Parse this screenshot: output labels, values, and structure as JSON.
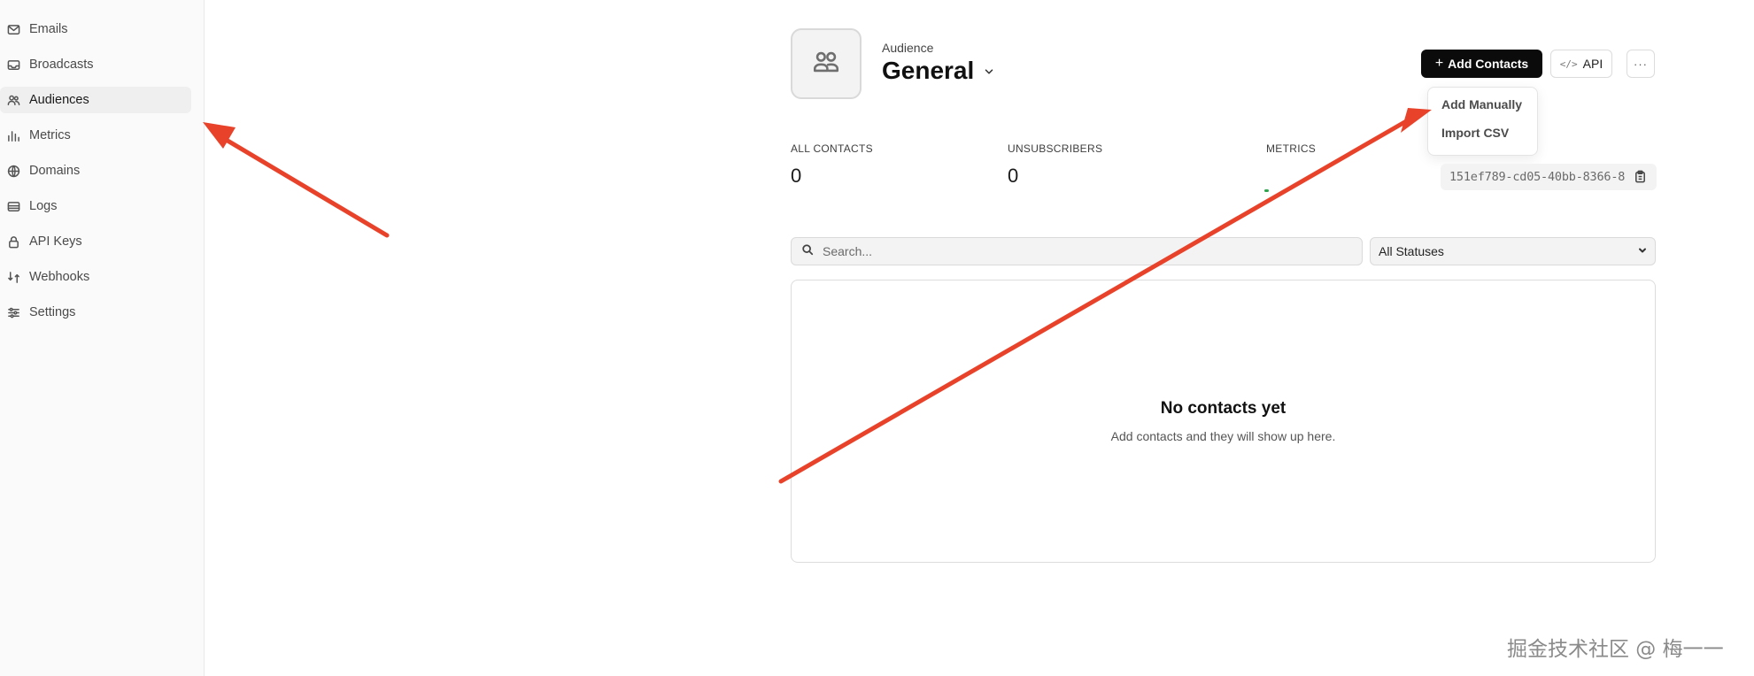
{
  "sidebar": {
    "items": [
      {
        "label": "Emails",
        "icon": "mail-icon",
        "active": false
      },
      {
        "label": "Broadcasts",
        "icon": "inbox-icon",
        "active": false
      },
      {
        "label": "Audiences",
        "icon": "users-icon",
        "active": true
      },
      {
        "label": "Metrics",
        "icon": "bar-chart-icon",
        "active": false
      },
      {
        "label": "Domains",
        "icon": "globe-icon",
        "active": false
      },
      {
        "label": "Logs",
        "icon": "logs-icon",
        "active": false
      },
      {
        "label": "API Keys",
        "icon": "lock-icon",
        "active": false
      },
      {
        "label": "Webhooks",
        "icon": "webhook-icon",
        "active": false
      },
      {
        "label": "Settings",
        "icon": "sliders-icon",
        "active": false
      }
    ]
  },
  "header": {
    "caption": "Audience",
    "title": "General",
    "avatar_icon": "users-icon"
  },
  "actions": {
    "add_contacts": "Add Contacts",
    "add_icon": "+",
    "api": "API",
    "api_icon": "</>",
    "more": "···"
  },
  "dropdown": {
    "items": [
      "Add Manually",
      "Import CSV"
    ]
  },
  "stats": {
    "all_contacts": {
      "label": "ALL CONTACTS",
      "value": "0"
    },
    "unsubscribers": {
      "label": "UNSUBSCRIBERS",
      "value": "0"
    },
    "metrics": {
      "label": "METRICS"
    }
  },
  "audience_id": "151ef789-cd05-40bb-8366-8",
  "search": {
    "placeholder": "Search..."
  },
  "filter": {
    "selected": "All Statuses"
  },
  "empty_state": {
    "title": "No contacts yet",
    "subtitle": "Add contacts and they will show up here."
  },
  "annotation": {
    "arrow_color": "#e8432a"
  },
  "watermark": "掘金技术社区 @ 梅一一"
}
